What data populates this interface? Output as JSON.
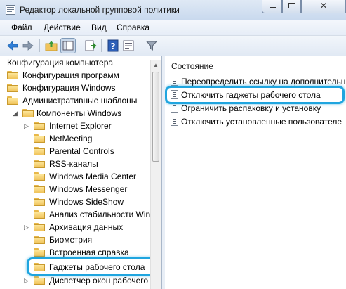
{
  "window": {
    "title": "Редактор локальной групповой политики",
    "controls": {
      "close_glyph": "✕"
    }
  },
  "menu": [
    {
      "label": "Файл"
    },
    {
      "label": "Действие"
    },
    {
      "label": "Вид"
    },
    {
      "label": "Справка"
    }
  ],
  "toolbar": {
    "buttons": [
      "back-arrow-icon",
      "forward-arrow-icon",
      "up-folder-icon",
      "show-hide-tree-icon",
      "export-list-icon",
      "help-icon",
      "properties-icon",
      "filter-icon"
    ]
  },
  "tree": {
    "items": [
      {
        "label": "Конфигурация компьютера",
        "expander": "",
        "icon": "none"
      },
      {
        "label": "Конфигурация программ",
        "expander": "",
        "icon": "folder-icon"
      },
      {
        "label": "Конфигурация Windows",
        "expander": "",
        "icon": "folder-icon"
      },
      {
        "label": "Административные шаблоны",
        "expander": "",
        "icon": "folder-icon"
      },
      {
        "label": "Компоненты Windows",
        "expander": "◢",
        "icon": "folder-open-icon"
      },
      {
        "label": "Internet Explorer",
        "expander": "▷",
        "icon": "folder-icon"
      },
      {
        "label": "NetMeeting",
        "expander": "",
        "icon": "folder-icon"
      },
      {
        "label": "Parental Controls",
        "expander": "",
        "icon": "folder-icon"
      },
      {
        "label": "RSS-каналы",
        "expander": "",
        "icon": "folder-icon"
      },
      {
        "label": "Windows Media Center",
        "expander": "",
        "icon": "folder-icon"
      },
      {
        "label": "Windows Messenger",
        "expander": "",
        "icon": "folder-icon"
      },
      {
        "label": "Windows SideShow",
        "expander": "",
        "icon": "folder-icon"
      },
      {
        "label": "Анализ стабильности Win",
        "expander": "",
        "icon": "folder-icon"
      },
      {
        "label": "Архивация данных",
        "expander": "▷",
        "icon": "folder-icon"
      },
      {
        "label": "Биометрия",
        "expander": "",
        "icon": "folder-icon"
      },
      {
        "label": "Встроенная справка",
        "expander": "",
        "icon": "folder-icon"
      },
      {
        "label": "Гаджеты рабочего стола",
        "expander": "",
        "icon": "folder-icon",
        "selected": true
      },
      {
        "label": "Диспетчер окон рабочего",
        "expander": "▷",
        "icon": "folder-icon"
      }
    ]
  },
  "list": {
    "column_header": "Состояние",
    "items": [
      {
        "label": "Переопределить ссылку на дополнительн"
      },
      {
        "label": "Отключить гаджеты рабочего стола",
        "selected": true
      },
      {
        "label": "Ограничить распаковку и установку"
      },
      {
        "label": "Отключить установленные пользователе"
      }
    ]
  },
  "colors": {
    "highlight": "#1fa5df",
    "titlebar": "#c9d9ee",
    "folder": "#f0c35a"
  }
}
